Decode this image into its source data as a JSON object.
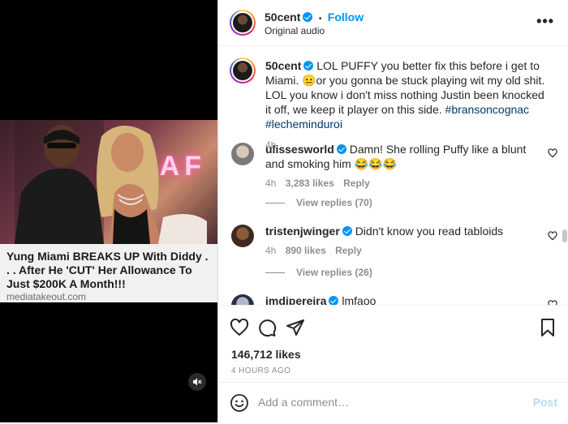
{
  "media": {
    "headline": "Yung Miami BREAKS UP With Diddy . . . After He 'CUT' Her Allowance To Just $200K A Month!!!",
    "source": "mediatakeout.com",
    "sign_text": "CAF",
    "mute_icon": "speaker-muted-icon"
  },
  "header": {
    "username": "50cent",
    "separator": "•",
    "follow_label": "Follow",
    "subtitle": "Original audio",
    "more_label": "•••"
  },
  "caption": {
    "username": "50cent",
    "text": "LOL PUFFY you better fix this before i get to Miami. 😐or you gonna be stuck playing wit my old shit. LOL you know i don't miss nothing Justin been knocked it off, we keep it player on this side.",
    "tags": [
      "#bransoncognac",
      "#lecheminduroi"
    ],
    "time": "4h"
  },
  "comments": [
    {
      "username": "ulissesworld",
      "text": "Damn! She rolling Puffy like a blunt and smoking him 😂😂😂",
      "time": "4h",
      "likes": "3,283 likes",
      "reply": "Reply",
      "view_replies": "View replies (70)"
    },
    {
      "username": "tristenjwinger",
      "text": "Didn't know you read tabloids",
      "time": "4h",
      "likes": "890 likes",
      "reply": "Reply",
      "view_replies": "View replies (26)"
    },
    {
      "username": "imdjpereira",
      "text": "lmfaoo"
    }
  ],
  "stats": {
    "likes": "146,712 likes",
    "ago": "4 HOURS AGO"
  },
  "add_comment": {
    "placeholder": "Add a comment…",
    "post_label": "Post"
  },
  "colors": {
    "accent": "#0095f6",
    "hashtag": "#00376b",
    "muted": "#8e8e8e",
    "post_disabled": "#b3dbff"
  }
}
